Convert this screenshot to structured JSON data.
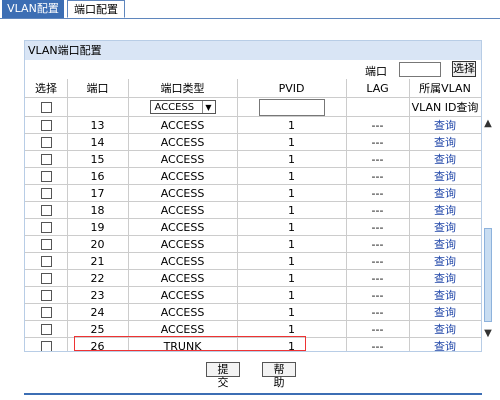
{
  "tabs": {
    "vlan_config": "VLAN配置",
    "port_config": "端口配置"
  },
  "panel": {
    "title": "VLAN端口配置"
  },
  "search": {
    "label": "端口",
    "button": "选择",
    "value": ""
  },
  "table": {
    "headers": {
      "select": "选择",
      "port": "端口",
      "port_type": "端口类型",
      "pvid": "PVID",
      "lag": "LAG",
      "vlan": "所属VLAN"
    },
    "filter": {
      "port_type_selected": "ACCESS",
      "pvid_value": "",
      "vlan_query": "VLAN ID查询"
    },
    "rows": [
      {
        "port": "13",
        "type": "ACCESS",
        "pvid": "1",
        "lag": "---",
        "action": "查询"
      },
      {
        "port": "14",
        "type": "ACCESS",
        "pvid": "1",
        "lag": "---",
        "action": "查询"
      },
      {
        "port": "15",
        "type": "ACCESS",
        "pvid": "1",
        "lag": "---",
        "action": "查询"
      },
      {
        "port": "16",
        "type": "ACCESS",
        "pvid": "1",
        "lag": "---",
        "action": "查询"
      },
      {
        "port": "17",
        "type": "ACCESS",
        "pvid": "1",
        "lag": "---",
        "action": "查询"
      },
      {
        "port": "18",
        "type": "ACCESS",
        "pvid": "1",
        "lag": "---",
        "action": "查询"
      },
      {
        "port": "19",
        "type": "ACCESS",
        "pvid": "1",
        "lag": "---",
        "action": "查询"
      },
      {
        "port": "20",
        "type": "ACCESS",
        "pvid": "1",
        "lag": "---",
        "action": "查询"
      },
      {
        "port": "21",
        "type": "ACCESS",
        "pvid": "1",
        "lag": "---",
        "action": "查询"
      },
      {
        "port": "22",
        "type": "ACCESS",
        "pvid": "1",
        "lag": "---",
        "action": "查询"
      },
      {
        "port": "23",
        "type": "ACCESS",
        "pvid": "1",
        "lag": "---",
        "action": "查询"
      },
      {
        "port": "24",
        "type": "ACCESS",
        "pvid": "1",
        "lag": "---",
        "action": "查询"
      },
      {
        "port": "25",
        "type": "ACCESS",
        "pvid": "1",
        "lag": "---",
        "action": "查询"
      },
      {
        "port": "26",
        "type": "TRUNK",
        "pvid": "1",
        "lag": "---",
        "action": "查询"
      }
    ]
  },
  "buttons": {
    "submit": "提交",
    "help": "帮助"
  },
  "colors": {
    "accent": "#3c6eb4",
    "panel_header": "#d9e5f5",
    "link": "#2046a8",
    "highlight": "#e33333"
  }
}
